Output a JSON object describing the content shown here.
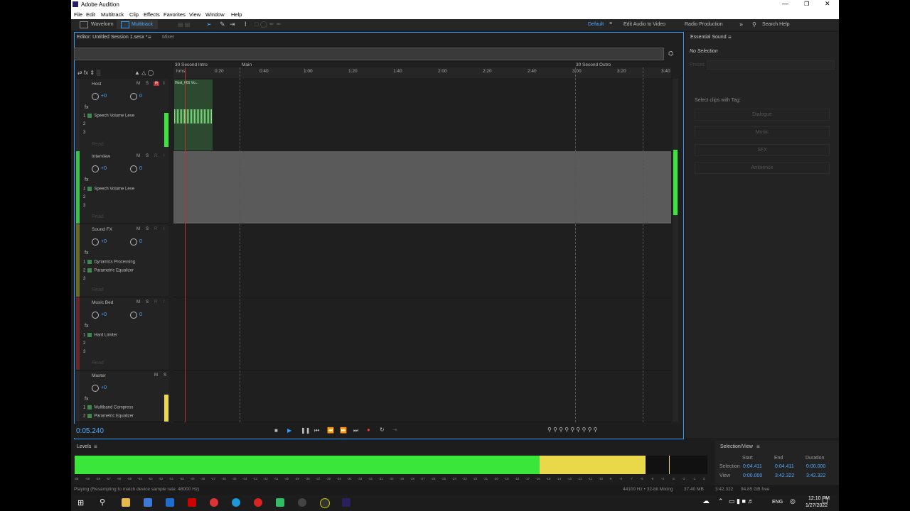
{
  "window": {
    "title": "Adobe Audition"
  },
  "menu": [
    "File",
    "Edit",
    "Multitrack",
    "Clip",
    "Effects",
    "Favorites",
    "View",
    "Window",
    "Help"
  ],
  "toolbar": {
    "waveform": "Waveform",
    "multitrack": "Multitrack",
    "workspace_default": "Default",
    "workspace_edit_video": "Edit Audio to Video",
    "workspace_radio": "Radio Production",
    "search_placeholder": "Search Help"
  },
  "editor": {
    "tab_label": "Editor: Untitled Session 1.sesx *",
    "mixer_tab": "Mixer"
  },
  "markers": {
    "intro": "30 Second Intro",
    "main": "Main",
    "outro": "30 Second Outro"
  },
  "ruler": [
    "hms",
    "0:20",
    "0:40",
    "1:00",
    "1:20",
    "1:40",
    "2:00",
    "2:20",
    "2:40",
    "3:00",
    "3:20",
    "3:40"
  ],
  "clip": {
    "name": "Host_001 Vo..."
  },
  "tracks": [
    {
      "name": "Host",
      "volume": "+0",
      "pan": "0",
      "fx": [
        "Speech Volume Leve",
        "",
        ""
      ],
      "read": "Read",
      "color": "#3cc24a"
    },
    {
      "name": "Interview",
      "volume": "+0",
      "pan": "0",
      "fx": [
        "Speech Volume Leve",
        "",
        ""
      ],
      "read": "Read",
      "color": "#3cc24a"
    },
    {
      "name": "Sound FX",
      "volume": "+0",
      "pan": "0",
      "fx": [
        "Dynamics Processing",
        "Parametric Equalizer",
        ""
      ],
      "read": "Read",
      "color": "#6b6b26"
    },
    {
      "name": "Music Bed",
      "volume": "+0",
      "pan": "0",
      "fx": [
        "Hard Limiter",
        "",
        ""
      ],
      "read": "Read",
      "color": "#6b2626"
    },
    {
      "name": "Master",
      "volume": "+0",
      "fx": [
        "Multiband Compress",
        "Parametric Equalizer"
      ],
      "color": "#333333"
    }
  ],
  "track_buttons": {
    "m": "M",
    "s": "S",
    "r": "R",
    "i": "I",
    "fx": "fx"
  },
  "transport": {
    "time": "0:05.240"
  },
  "essential_sound": {
    "title": "Essential Sound",
    "no_selection": "No Selection",
    "preset": "Preset:",
    "select_clips": "Select clips with Tag:",
    "tags": [
      "Dialogue",
      "Music",
      "SFX",
      "Ambience"
    ]
  },
  "levels": {
    "title": "Levels",
    "scale": [
      "dB",
      "-59",
      "-58",
      "-57",
      "-56",
      "-55",
      "-54",
      "-53",
      "-52",
      "-51",
      "-50",
      "-49",
      "-48",
      "-47",
      "-46",
      "-45",
      "-44",
      "-43",
      "-42",
      "-41",
      "-40",
      "-39",
      "-38",
      "-37",
      "-36",
      "-35",
      "-34",
      "-33",
      "-32",
      "-31",
      "-30",
      "-29",
      "-28",
      "-27",
      "-26",
      "-25",
      "-24",
      "-23",
      "-22",
      "-21",
      "-20",
      "-19",
      "-18",
      "-17",
      "-16",
      "-15",
      "-14",
      "-13",
      "-12",
      "-11",
      "-10",
      "-9",
      "-8",
      "-7",
      "-6",
      "-5",
      "-4",
      "-3",
      "-2",
      "-1",
      "0"
    ],
    "green_fraction": 0.735,
    "yellow_fraction": 0.902
  },
  "selection_view": {
    "title": "Selection/View",
    "headers": [
      "Start",
      "End",
      "Duration"
    ],
    "selection_label": "Selection",
    "view_label": "View",
    "selection": [
      "0:04.411",
      "0:04.411",
      "0:00.000"
    ],
    "view": [
      "0:00.000",
      "3:42.322",
      "3:42.322"
    ]
  },
  "status": {
    "message": "Playing (Resampling to match device sample rate: 48000 Hz)",
    "sample_rate": "44100 Hz • 32-bit Mixing",
    "memory": "37.40 MB",
    "duration": "3:42.322",
    "free": "94.85 GB free"
  },
  "taskbar": {
    "language": "ENG",
    "time": "12:10 PM",
    "date": "1/27/2022"
  },
  "colors": {
    "accent": "#2e9bff",
    "green": "#39e639",
    "yellow": "#e8d84a"
  }
}
